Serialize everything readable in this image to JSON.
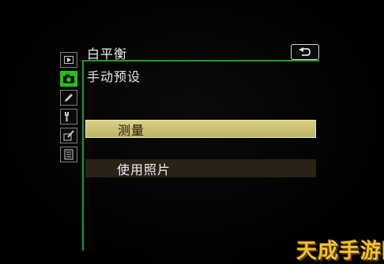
{
  "menu": {
    "title": "白平衡",
    "subtitle": "手动预设"
  },
  "tabs": [
    {
      "name": "playback-menu",
      "icon": "play-icon"
    },
    {
      "name": "shooting-menu",
      "icon": "camera-icon",
      "active": true
    },
    {
      "name": "custom-settings-menu",
      "icon": "pencil-icon"
    },
    {
      "name": "setup-menu",
      "icon": "wrench-icon"
    },
    {
      "name": "retouch-menu",
      "icon": "retouch-icon"
    },
    {
      "name": "my-menu",
      "icon": "list-icon"
    }
  ],
  "options": [
    {
      "label": "测量",
      "selected": true
    },
    {
      "label": "使用照片",
      "selected": false
    }
  ],
  "back_button": {
    "icon": "return-arrow-icon"
  },
  "watermark": "天成手游网",
  "colors": {
    "accent_green": "#1f9a2a",
    "active_tab": "#1ec21e",
    "selection": "#d9cf86"
  }
}
